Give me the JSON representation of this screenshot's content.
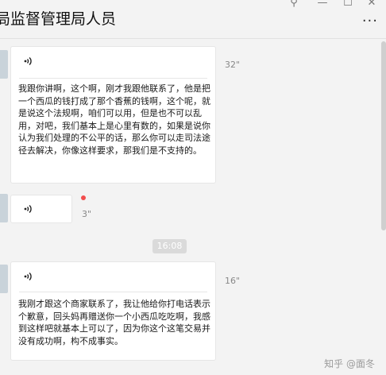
{
  "window": {
    "title": "局监督管理局人员",
    "controls": [
      "⚲",
      "—",
      "☐",
      "✕"
    ],
    "more_label": "···"
  },
  "messages": [
    {
      "duration": "32\"",
      "transcript": "我跟你讲啊，这个啊，刚才我跟他联系了，他是把一个西瓜的钱打成了那个香蕉的钱啊，这个呢，就是说这个法规啊，咱们可以用，但是也不可以乱用，对吧，我们基本上是心里有数的，如果是说你认为我们处理的不公平的话，那么你可以走司法途径去解决，你像这样要求，那我们是不支持的。"
    },
    {
      "duration": "3\"",
      "unread": true
    },
    {
      "duration": "16\"",
      "transcript": "我刚才跟这个商家联系了，我让他给你打电话表示个歉意，回头妈再赠送你一个小西瓜吃吃啊，我感到这样吧就基本上可以了，因为你这个这笔交易并没有成功啊，构不成事实。"
    }
  ],
  "time_divider": "16:08",
  "watermark": "知乎 @面冬",
  "colors": {
    "unread_dot": "#f24d4d",
    "bubble": "#ffffff",
    "background": "#f3f3f3"
  }
}
